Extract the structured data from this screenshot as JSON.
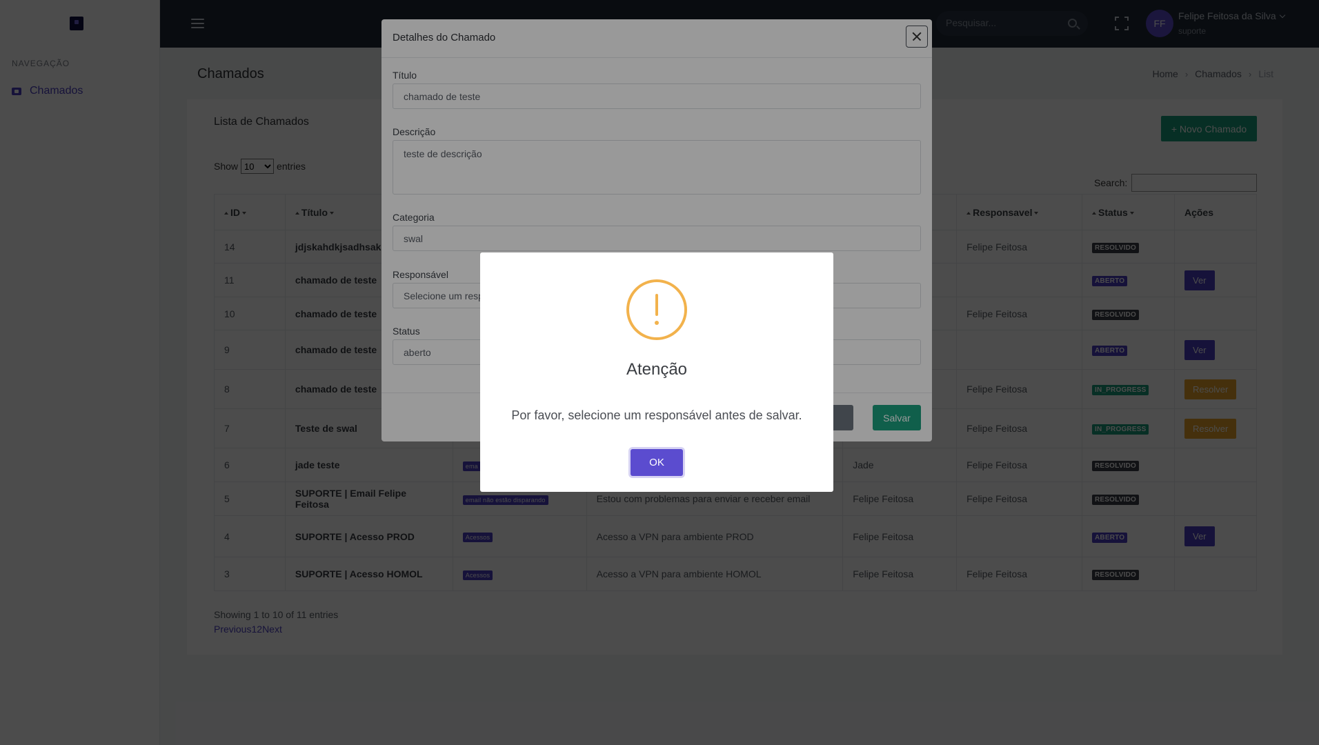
{
  "sidebar": {
    "nav_header": "NAVEGAÇÃO",
    "items": [
      {
        "label": "Chamados",
        "icon": "ticket-icon"
      }
    ]
  },
  "topbar": {
    "search_placeholder": "Pesquisar...",
    "user_initials": "FF",
    "user_name": "Felipe Feitosa da Silva",
    "user_role": "suporte"
  },
  "page": {
    "title": "Chamados",
    "breadcrumb": [
      "Home",
      "Chamados",
      "List"
    ]
  },
  "card": {
    "title": "Lista de Chamados",
    "new_button": "+ Novo Chamado",
    "show_label": "Show",
    "entries_label": "entries",
    "entries_value": "10",
    "search_label": "Search:"
  },
  "table": {
    "headers": [
      "ID",
      "Título",
      "",
      "",
      "",
      "Responsavel",
      "Status",
      "Ações"
    ],
    "rows": [
      {
        "id": "14",
        "titulo": "jdjskahdkjsadhsak",
        "categoria": "",
        "descricao": "",
        "solicitante": "",
        "responsavel": "Felipe Feitosa",
        "status": "RESOLVIDO",
        "acao": ""
      },
      {
        "id": "11",
        "titulo": "chamado de teste",
        "categoria": "",
        "descricao": "",
        "solicitante": "",
        "responsavel": "",
        "status": "ABERTO",
        "acao": "Ver"
      },
      {
        "id": "10",
        "titulo": "chamado de teste",
        "categoria": "",
        "descricao": "",
        "solicitante": "",
        "responsavel": "Felipe Feitosa",
        "status": "RESOLVIDO",
        "acao": ""
      },
      {
        "id": "9",
        "titulo": "chamado de teste",
        "categoria": "",
        "descricao": "",
        "solicitante": "",
        "responsavel": "",
        "status": "ABERTO",
        "acao": "Ver"
      },
      {
        "id": "8",
        "titulo": "chamado de teste",
        "categoria": "",
        "descricao": "",
        "solicitante": "",
        "responsavel": "Felipe Feitosa",
        "status": "IN_PROGRESS",
        "acao": "Resolver"
      },
      {
        "id": "7",
        "titulo": "Teste de swal",
        "categoria": "",
        "descricao": "",
        "solicitante": "",
        "responsavel": "Felipe Feitosa",
        "status": "IN_PROGRESS",
        "acao": "Resolver"
      },
      {
        "id": "6",
        "titulo": "jade teste",
        "categoria": "ema",
        "descricao": "",
        "solicitante": "Jade",
        "responsavel": "Felipe Feitosa",
        "status": "RESOLVIDO",
        "acao": ""
      },
      {
        "id": "5",
        "titulo": "SUPORTE | Email Felipe Feitosa",
        "categoria": "email não estão disparando",
        "descricao": "Estou com problemas para enviar e receber email",
        "solicitante": "Felipe Feitosa",
        "responsavel": "Felipe Feitosa",
        "status": "RESOLVIDO",
        "acao": ""
      },
      {
        "id": "4",
        "titulo": "SUPORTE | Acesso PROD",
        "categoria": "Acessos",
        "descricao": "Acesso a VPN para ambiente PROD",
        "solicitante": "Felipe Feitosa",
        "responsavel": "",
        "status": "ABERTO",
        "acao": "Ver"
      },
      {
        "id": "3",
        "titulo": "SUPORTE | Acesso HOMOL",
        "categoria": "Acessos",
        "descricao": "Acesso a VPN para ambiente HOMOL",
        "solicitante": "Felipe Feitosa",
        "responsavel": "Felipe Feitosa",
        "status": "RESOLVIDO",
        "acao": ""
      }
    ],
    "info": "Showing 1 to 10 of 11 entries",
    "pager": [
      "Previous",
      "1",
      "2",
      "Next"
    ]
  },
  "modal": {
    "title": "Detalhes do Chamado",
    "titulo_label": "Título",
    "titulo_value": "chamado de teste",
    "descricao_label": "Descrição",
    "descricao_value": "teste de descrição",
    "categoria_label": "Categoria",
    "categoria_value": "swal",
    "responsavel_label": "Responsável",
    "responsavel_value": "Selecione um resp",
    "status_label": "Status",
    "status_value": "aberto",
    "cancel_label": "ncelar",
    "save_label": "Salvar"
  },
  "alert": {
    "title": "Atenção",
    "text": "Por favor, selecione um responsável antes de salvar.",
    "ok_label": "OK"
  }
}
